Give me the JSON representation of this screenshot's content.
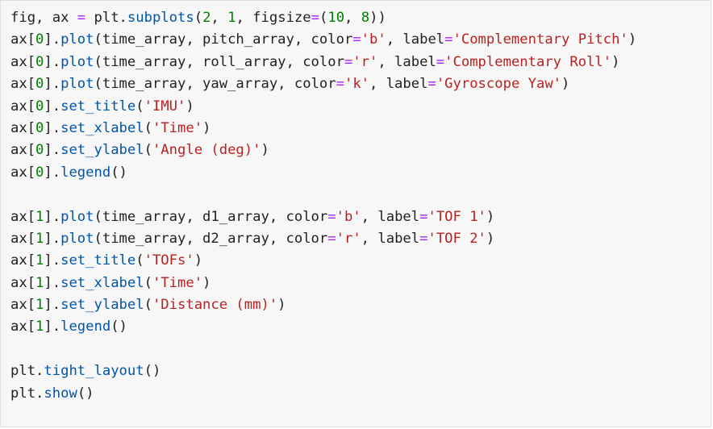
{
  "code_cell": {
    "lines": [
      [
        {
          "t": "fig, ax ",
          "c": ""
        },
        {
          "t": "=",
          "c": "op"
        },
        {
          "t": " plt.",
          "c": ""
        },
        {
          "t": "subplots",
          "c": "attr"
        },
        {
          "t": "(",
          "c": ""
        },
        {
          "t": "2",
          "c": "num"
        },
        {
          "t": ", ",
          "c": ""
        },
        {
          "t": "1",
          "c": "num"
        },
        {
          "t": ", figsize",
          "c": ""
        },
        {
          "t": "=",
          "c": "op"
        },
        {
          "t": "(",
          "c": ""
        },
        {
          "t": "10",
          "c": "num"
        },
        {
          "t": ", ",
          "c": ""
        },
        {
          "t": "8",
          "c": "num"
        },
        {
          "t": "))",
          "c": ""
        }
      ],
      [
        {
          "t": "ax[",
          "c": ""
        },
        {
          "t": "0",
          "c": "num"
        },
        {
          "t": "].",
          "c": ""
        },
        {
          "t": "plot",
          "c": "attr"
        },
        {
          "t": "(time_array, pitch_array, color",
          "c": ""
        },
        {
          "t": "=",
          "c": "op"
        },
        {
          "t": "'b'",
          "c": "str"
        },
        {
          "t": ", label",
          "c": ""
        },
        {
          "t": "=",
          "c": "op"
        },
        {
          "t": "'Complementary Pitch'",
          "c": "str"
        },
        {
          "t": ")",
          "c": ""
        }
      ],
      [
        {
          "t": "ax[",
          "c": ""
        },
        {
          "t": "0",
          "c": "num"
        },
        {
          "t": "].",
          "c": ""
        },
        {
          "t": "plot",
          "c": "attr"
        },
        {
          "t": "(time_array, roll_array, color",
          "c": ""
        },
        {
          "t": "=",
          "c": "op"
        },
        {
          "t": "'r'",
          "c": "str"
        },
        {
          "t": ", label",
          "c": ""
        },
        {
          "t": "=",
          "c": "op"
        },
        {
          "t": "'Complementary Roll'",
          "c": "str"
        },
        {
          "t": ")",
          "c": ""
        }
      ],
      [
        {
          "t": "ax[",
          "c": ""
        },
        {
          "t": "0",
          "c": "num"
        },
        {
          "t": "].",
          "c": ""
        },
        {
          "t": "plot",
          "c": "attr"
        },
        {
          "t": "(time_array, yaw_array, color",
          "c": ""
        },
        {
          "t": "=",
          "c": "op"
        },
        {
          "t": "'k'",
          "c": "str"
        },
        {
          "t": ", label",
          "c": ""
        },
        {
          "t": "=",
          "c": "op"
        },
        {
          "t": "'Gyroscope Yaw'",
          "c": "str"
        },
        {
          "t": ")",
          "c": ""
        }
      ],
      [
        {
          "t": "ax[",
          "c": ""
        },
        {
          "t": "0",
          "c": "num"
        },
        {
          "t": "].",
          "c": ""
        },
        {
          "t": "set_title",
          "c": "attr"
        },
        {
          "t": "(",
          "c": ""
        },
        {
          "t": "'IMU'",
          "c": "str"
        },
        {
          "t": ")",
          "c": ""
        }
      ],
      [
        {
          "t": "ax[",
          "c": ""
        },
        {
          "t": "0",
          "c": "num"
        },
        {
          "t": "].",
          "c": ""
        },
        {
          "t": "set_xlabel",
          "c": "attr"
        },
        {
          "t": "(",
          "c": ""
        },
        {
          "t": "'Time'",
          "c": "str"
        },
        {
          "t": ")",
          "c": ""
        }
      ],
      [
        {
          "t": "ax[",
          "c": ""
        },
        {
          "t": "0",
          "c": "num"
        },
        {
          "t": "].",
          "c": ""
        },
        {
          "t": "set_ylabel",
          "c": "attr"
        },
        {
          "t": "(",
          "c": ""
        },
        {
          "t": "'Angle (deg)'",
          "c": "str"
        },
        {
          "t": ")",
          "c": ""
        }
      ],
      [
        {
          "t": "ax[",
          "c": ""
        },
        {
          "t": "0",
          "c": "num"
        },
        {
          "t": "].",
          "c": ""
        },
        {
          "t": "legend",
          "c": "attr"
        },
        {
          "t": "()",
          "c": ""
        }
      ],
      [],
      [
        {
          "t": "ax[",
          "c": ""
        },
        {
          "t": "1",
          "c": "num"
        },
        {
          "t": "].",
          "c": ""
        },
        {
          "t": "plot",
          "c": "attr"
        },
        {
          "t": "(time_array, d1_array, color",
          "c": ""
        },
        {
          "t": "=",
          "c": "op"
        },
        {
          "t": "'b'",
          "c": "str"
        },
        {
          "t": ", label",
          "c": ""
        },
        {
          "t": "=",
          "c": "op"
        },
        {
          "t": "'TOF 1'",
          "c": "str"
        },
        {
          "t": ")",
          "c": ""
        }
      ],
      [
        {
          "t": "ax[",
          "c": ""
        },
        {
          "t": "1",
          "c": "num"
        },
        {
          "t": "].",
          "c": ""
        },
        {
          "t": "plot",
          "c": "attr"
        },
        {
          "t": "(time_array, d2_array, color",
          "c": ""
        },
        {
          "t": "=",
          "c": "op"
        },
        {
          "t": "'r'",
          "c": "str"
        },
        {
          "t": ", label",
          "c": ""
        },
        {
          "t": "=",
          "c": "op"
        },
        {
          "t": "'TOF 2'",
          "c": "str"
        },
        {
          "t": ")",
          "c": ""
        }
      ],
      [
        {
          "t": "ax[",
          "c": ""
        },
        {
          "t": "1",
          "c": "num"
        },
        {
          "t": "].",
          "c": ""
        },
        {
          "t": "set_title",
          "c": "attr"
        },
        {
          "t": "(",
          "c": ""
        },
        {
          "t": "'TOFs'",
          "c": "str"
        },
        {
          "t": ")",
          "c": ""
        }
      ],
      [
        {
          "t": "ax[",
          "c": ""
        },
        {
          "t": "1",
          "c": "num"
        },
        {
          "t": "].",
          "c": ""
        },
        {
          "t": "set_xlabel",
          "c": "attr"
        },
        {
          "t": "(",
          "c": ""
        },
        {
          "t": "'Time'",
          "c": "str"
        },
        {
          "t": ")",
          "c": ""
        }
      ],
      [
        {
          "t": "ax[",
          "c": ""
        },
        {
          "t": "1",
          "c": "num"
        },
        {
          "t": "].",
          "c": ""
        },
        {
          "t": "set_ylabel",
          "c": "attr"
        },
        {
          "t": "(",
          "c": ""
        },
        {
          "t": "'Distance (mm)'",
          "c": "str"
        },
        {
          "t": ")",
          "c": ""
        }
      ],
      [
        {
          "t": "ax[",
          "c": ""
        },
        {
          "t": "1",
          "c": "num"
        },
        {
          "t": "].",
          "c": ""
        },
        {
          "t": "legend",
          "c": "attr"
        },
        {
          "t": "()",
          "c": ""
        }
      ],
      [],
      [
        {
          "t": "plt.",
          "c": ""
        },
        {
          "t": "tight_layout",
          "c": "attr"
        },
        {
          "t": "()",
          "c": ""
        }
      ],
      [
        {
          "t": "plt.",
          "c": ""
        },
        {
          "t": "show",
          "c": "attr"
        },
        {
          "t": "()",
          "c": ""
        }
      ]
    ]
  },
  "colors": {
    "background": "#f7f7f7",
    "border": "#dfdfdf",
    "text": "#212121",
    "number": "#008000",
    "string": "#ba2121",
    "operator": "#aa22ff",
    "attribute": "#0055aa"
  }
}
